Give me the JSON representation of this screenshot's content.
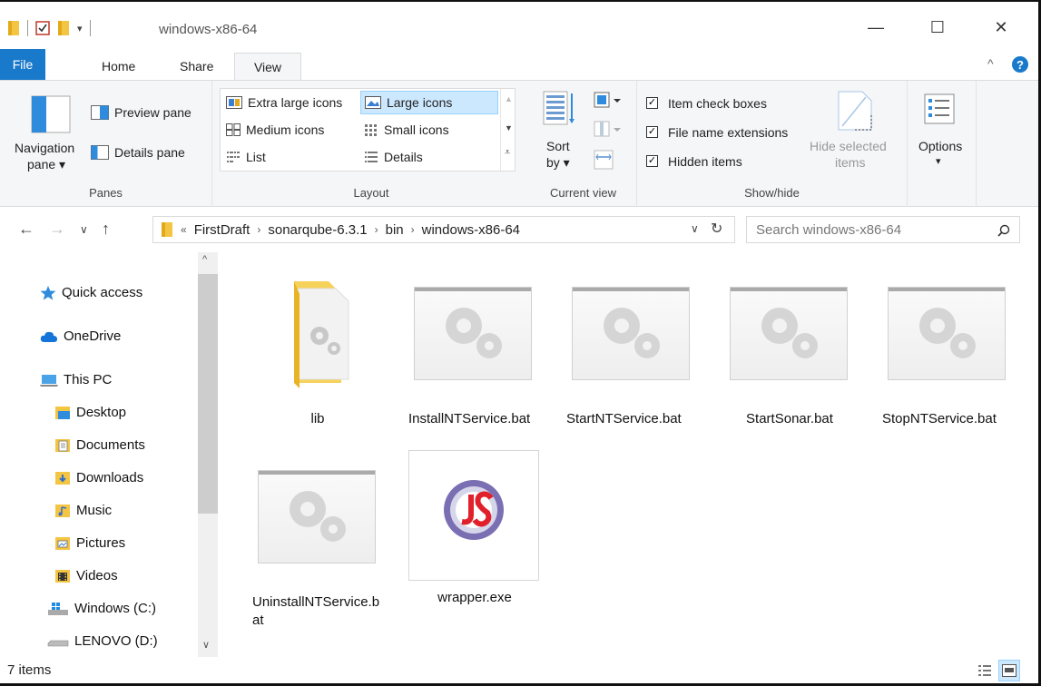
{
  "window": {
    "title": "windows-x86-64",
    "controls": {
      "minimize": "—",
      "maximize": "☐",
      "close": "✕"
    }
  },
  "tabs": [
    {
      "label": "File"
    },
    {
      "label": "Home"
    },
    {
      "label": "Share"
    },
    {
      "label": "View"
    }
  ],
  "ribbon": {
    "panes": {
      "label": "Panes",
      "navigation_pane": "Navigation",
      "navigation_pane_sub": "pane ▾",
      "preview_pane": "Preview pane",
      "details_pane": "Details pane"
    },
    "layout": {
      "label": "Layout",
      "items": [
        "Extra large icons",
        "Large icons",
        "Medium icons",
        "Small icons",
        "List",
        "Details"
      ],
      "selected": "Large icons"
    },
    "current_view": {
      "label": "Current view",
      "sort": "Sort",
      "sort_sub": "by ▾"
    },
    "show_hide": {
      "label": "Show/hide",
      "item_check_boxes": "Item check boxes",
      "file_name_extensions": "File name extensions",
      "hidden_items": "Hidden items",
      "hide_selected": "Hide selected",
      "hide_selected_sub": "items"
    },
    "options": {
      "label": "Options",
      "sub": "▾"
    }
  },
  "address": {
    "breadcrumbs": [
      "FirstDraft",
      "sonarqube-6.3.1",
      "bin",
      "windows-x86-64"
    ],
    "overflow": "«",
    "search_placeholder": "Search windows-x86-64"
  },
  "nav_pane": {
    "items": [
      {
        "label": "Quick access",
        "icon": "star-icon"
      },
      {
        "label": "OneDrive",
        "icon": "cloud-icon"
      },
      {
        "label": "This PC",
        "icon": "computer-icon"
      },
      {
        "label": "Desktop",
        "icon": "desktop-folder-icon"
      },
      {
        "label": "Documents",
        "icon": "documents-icon"
      },
      {
        "label": "Downloads",
        "icon": "downloads-icon"
      },
      {
        "label": "Music",
        "icon": "music-icon"
      },
      {
        "label": "Pictures",
        "icon": "pictures-icon"
      },
      {
        "label": "Videos",
        "icon": "videos-icon"
      },
      {
        "label": "Windows (C:)",
        "icon": "windows-drive-icon"
      },
      {
        "label": "LENOVO (D:)",
        "icon": "drive-icon"
      }
    ]
  },
  "files": [
    {
      "name": "lib",
      "type": "folder"
    },
    {
      "name": "InstallNTService.bat",
      "type": "bat"
    },
    {
      "name": "StartNTService.bat",
      "type": "bat"
    },
    {
      "name": "StartSonar.bat",
      "type": "bat"
    },
    {
      "name": "StopNTService.bat",
      "type": "bat"
    },
    {
      "name": "UninstallNTService.bat",
      "type": "bat"
    },
    {
      "name": "wrapper.exe",
      "type": "exe"
    }
  ],
  "status": {
    "items": "7 items"
  },
  "colors": {
    "accent": "#1979ca",
    "selection": "#cce8ff"
  }
}
